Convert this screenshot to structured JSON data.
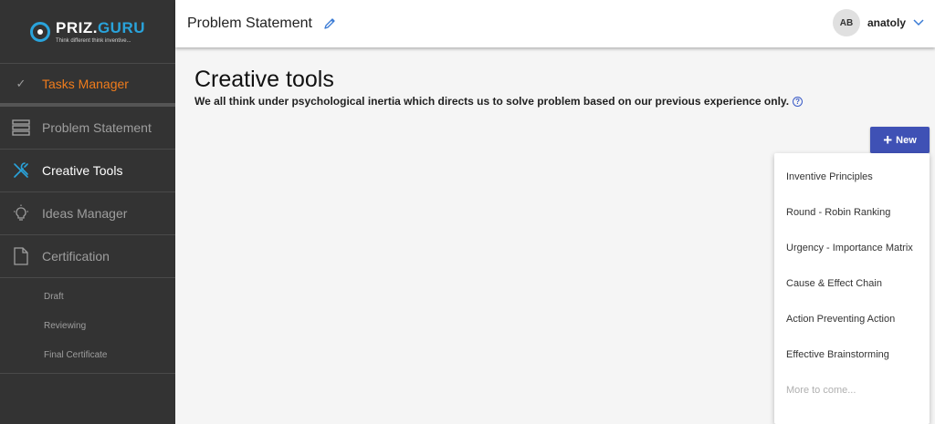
{
  "logo": {
    "name_part1": "PRIZ.",
    "name_part2": "GURU",
    "tagline": "Think different  think inventive..."
  },
  "sidebar": {
    "items": [
      {
        "label": "Tasks Manager",
        "icon": "check-icon"
      },
      {
        "label": "Problem Statement",
        "icon": "layers-icon"
      },
      {
        "label": "Creative Tools",
        "icon": "tools-icon"
      },
      {
        "label": "Ideas Manager",
        "icon": "lightbulb-icon"
      },
      {
        "label": "Certification",
        "icon": "document-icon"
      }
    ],
    "sub_items": [
      "Draft",
      "Reviewing",
      "Final Certificate"
    ]
  },
  "header": {
    "title": "Problem Statement",
    "user_initials": "AB",
    "username": "anatoly"
  },
  "main": {
    "title": "Creative tools",
    "subtitle": "We all think under psychological inertia which directs us to solve problem based on our previous experience only.",
    "new_button": "New"
  },
  "menu": {
    "items": [
      "Inventive Principles",
      "Round - Robin Ranking",
      "Urgency - Importance Matrix",
      "Cause & Effect Chain",
      "Action Preventing Action",
      "Effective Brainstorming"
    ],
    "disabled_item": "More to come..."
  },
  "colors": {
    "accent": "#3f51b5",
    "active_nav": "#f07c1c",
    "logo_blue": "#29a3db",
    "sidebar_bg": "#333333"
  }
}
